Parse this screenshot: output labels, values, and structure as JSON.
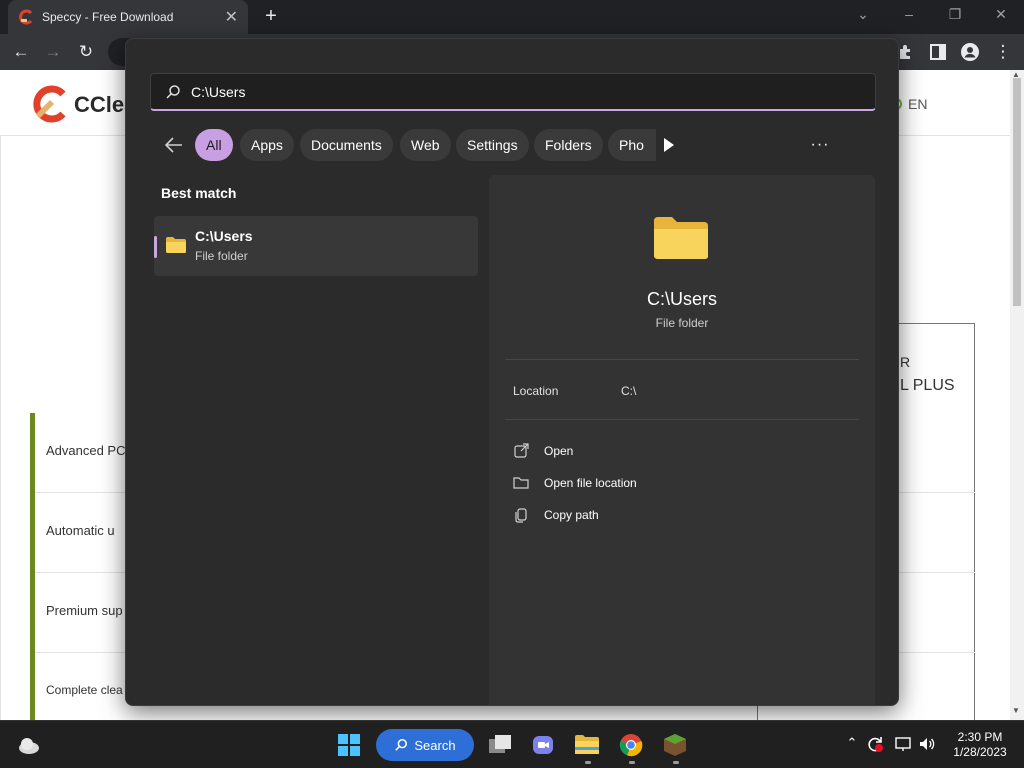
{
  "browser": {
    "tab_title": "Speccy - Free Download",
    "tab_close": "✕",
    "new_tab": "+"
  },
  "website": {
    "logo_text": "CClea",
    "language": "EN",
    "plan_title_line1": "R",
    "plan_title_line2": "L PLUS",
    "features": [
      "Advanced PC",
      "Automatic u",
      "Premium sup",
      "Complete clea"
    ]
  },
  "search": {
    "query": "C:\\Users",
    "filters": [
      "All",
      "Apps",
      "Documents",
      "Web",
      "Settings",
      "Folders",
      "Pho"
    ],
    "active_filter": "All",
    "more_label": "···",
    "section_label": "Best match",
    "best_match": {
      "title": "C:\\Users",
      "subtitle": "File folder"
    },
    "details": {
      "title": "C:\\Users",
      "subtitle": "File folder",
      "location_label": "Location",
      "location_value": "C:\\",
      "actions": [
        "Open",
        "Open file location",
        "Copy path"
      ]
    }
  },
  "taskbar": {
    "search_label": "Search",
    "time": "2:30 PM",
    "date": "1/28/2023"
  },
  "colors": {
    "accent": "#c89fe2",
    "flyout_bg": "#2b2b2b",
    "folder_yellow": "#f9d45c",
    "taskbar_search": "#2d6fd6"
  }
}
